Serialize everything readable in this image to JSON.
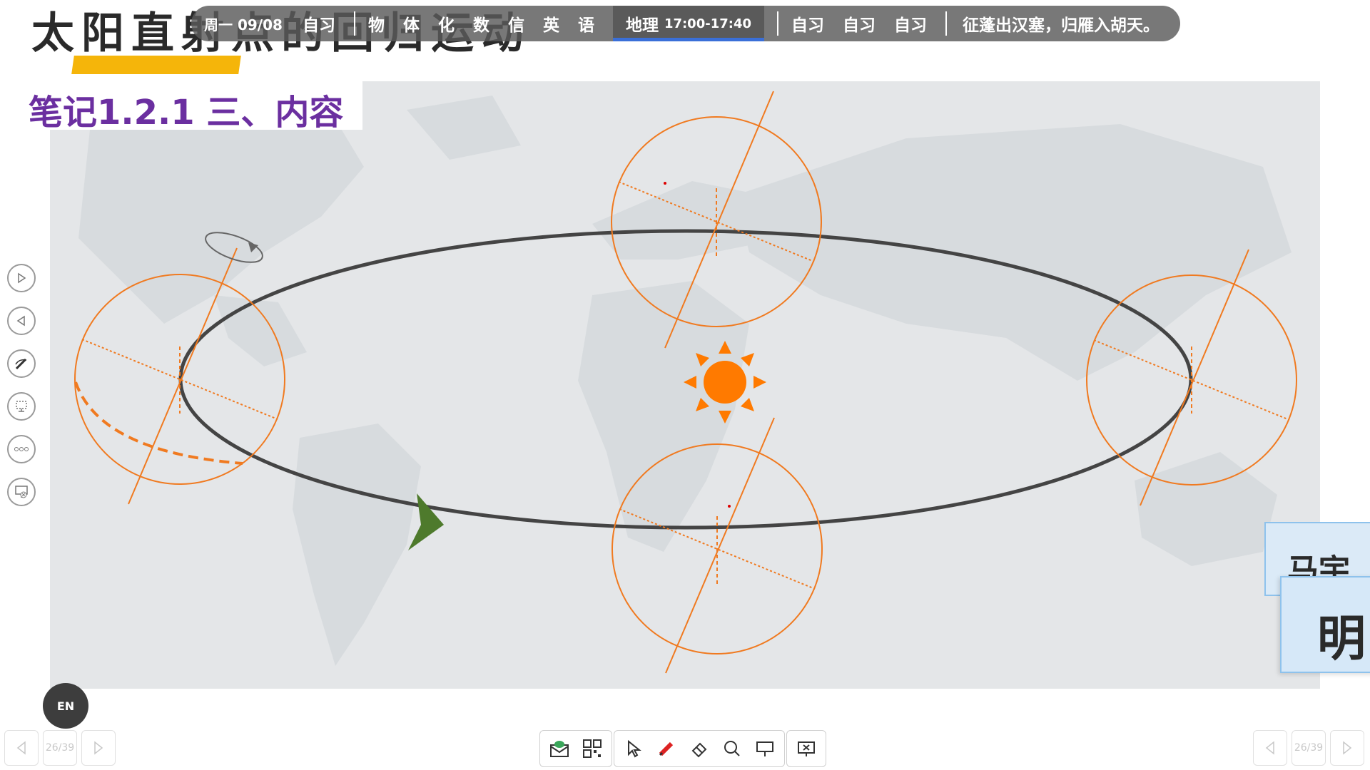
{
  "slide": {
    "title": "太阳直射点的回归运动",
    "subtitle": "笔记1.2.1 三、内容"
  },
  "schedule": {
    "date": "周一 09/08",
    "items_before": [
      "自习"
    ],
    "subjects": [
      "物",
      "体",
      "化",
      "数",
      "信",
      "英",
      "语"
    ],
    "current_subject": "地理",
    "current_time": "17:00-17:40",
    "items_after": [
      "自习",
      "自习",
      "自习"
    ],
    "quote": "征蓬出汉塞，归雁入胡天。",
    "highlight_color": "#3a6fd8"
  },
  "side_toolbar": {
    "buttons": [
      {
        "name": "next-icon",
        "glyph": "▷"
      },
      {
        "name": "previous-icon",
        "glyph": "◁"
      },
      {
        "name": "pen-icon",
        "glyph": "✎"
      },
      {
        "name": "screen-annotate-icon",
        "glyph": "⎚"
      },
      {
        "name": "more-icon",
        "glyph": "∘∘∘"
      },
      {
        "name": "close-presentation-icon",
        "glyph": "⊠"
      }
    ]
  },
  "en_button": {
    "label": "EN"
  },
  "page_nav": {
    "left_indicator": "26/39",
    "right_indicator": "26/39"
  },
  "bottom_toolbar": {
    "groups": [
      [
        "mail-icon",
        "qrcode-icon"
      ],
      [
        "cursor-icon",
        "pen-icon",
        "eraser-icon",
        "magnifier-icon",
        "whiteboard-icon"
      ],
      [
        "exit-icon"
      ]
    ]
  },
  "name_cards": {
    "card1": "马宇",
    "card2": "明"
  },
  "diagram": {
    "orbit_color": "#444444",
    "earth_color": "#f07a20",
    "sun_color": "#ff7a00",
    "arrow_color": "#4e7a2c"
  }
}
